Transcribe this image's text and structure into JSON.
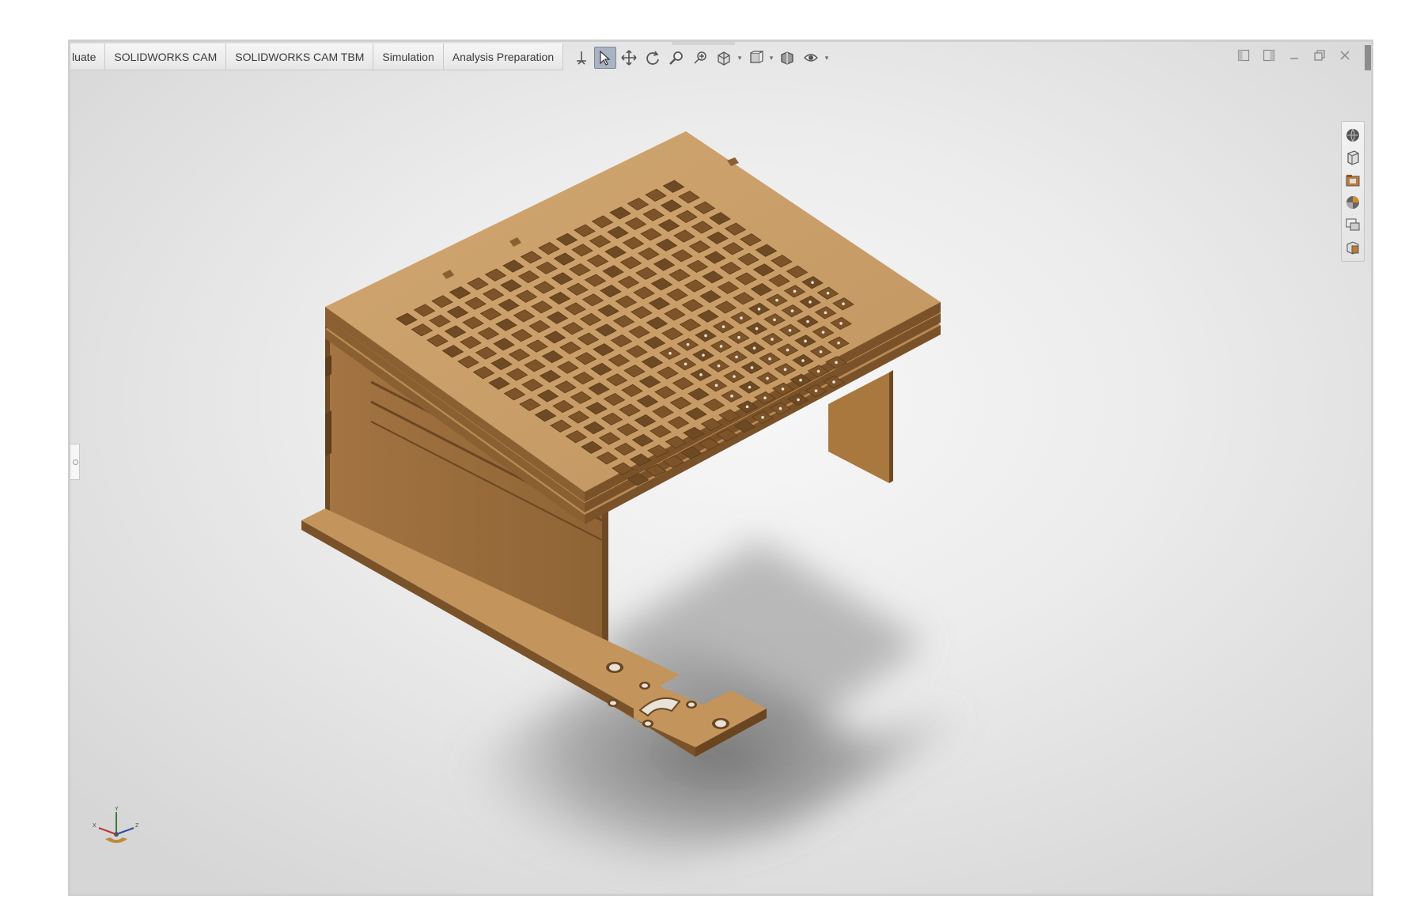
{
  "tabs": [
    {
      "label": "luate"
    },
    {
      "label": "SOLIDWORKS CAM"
    },
    {
      "label": "SOLIDWORKS CAM TBM"
    },
    {
      "label": "Simulation"
    },
    {
      "label": "Analysis Preparation"
    }
  ],
  "heads_up_toolbar": [
    "normal-to-icon",
    "select-icon",
    "pan-icon",
    "rotate-icon",
    "zoom-to-area-icon",
    "previous-view-icon",
    "section-view-icon",
    "view-orientation-icon",
    "display-style-icon",
    "hide-show-items-icon",
    "edit-appearance-icon"
  ],
  "window_controls": [
    "tile-left-icon",
    "tile-right-icon",
    "minimize-icon",
    "restore-icon",
    "close-icon"
  ],
  "task_pane": [
    "solidworks-resources-icon",
    "design-library-icon",
    "file-explorer-icon",
    "view-palette-icon",
    "appearances-icon",
    "custom-properties-icon"
  ],
  "triad_axes": {
    "x": "X",
    "y": "Y",
    "z": "Z"
  },
  "colors": {
    "wood_top": "#caa06a",
    "wood_side": "#a97a45",
    "wood_dark": "#7a5229",
    "viewport_center": "#f7f7f7",
    "viewport_edge": "#d6d6d6",
    "active_tool": "#a9b3c3"
  }
}
